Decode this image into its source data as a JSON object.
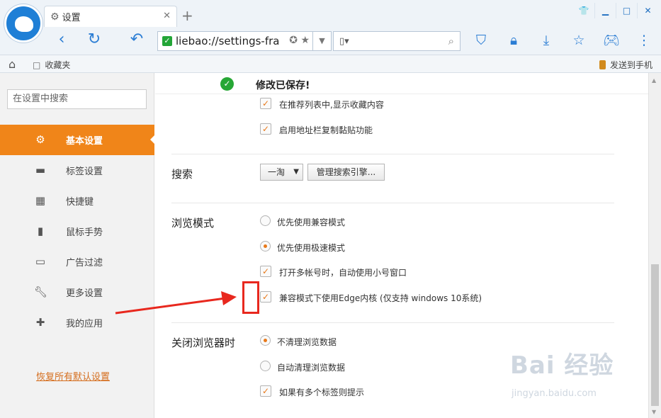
{
  "browser": {
    "tab_title": "设置",
    "tab_close": "✕",
    "new_tab": "+",
    "address_url": "liebao://settings-fra",
    "search_placeholder": "",
    "window_controls": [
      "shirt-icon",
      "minimize-icon",
      "maximize-icon",
      "close-icon"
    ]
  },
  "bookmarks": {
    "favorites_label": "收藏夹",
    "send_to_phone": "发送到手机"
  },
  "sidebar": {
    "search_placeholder": "在设置中搜索",
    "items": [
      {
        "label": "基本设置",
        "icon": "gear-icon",
        "active": true
      },
      {
        "label": "标签设置",
        "icon": "laptop-icon",
        "active": false
      },
      {
        "label": "快捷键",
        "icon": "keyboard-icon",
        "active": false
      },
      {
        "label": "鼠标手势",
        "icon": "mouse-icon",
        "active": false
      },
      {
        "label": "广告过滤",
        "icon": "window-icon",
        "active": false
      },
      {
        "label": "更多设置",
        "icon": "wrench-icon",
        "active": false
      },
      {
        "label": "我的应用",
        "icon": "puzzle-icon",
        "active": false
      }
    ],
    "reset_link": "恢复所有默认设置"
  },
  "content": {
    "saved_message": "修改已保存!",
    "top_options": [
      {
        "label": "在推荐列表中,显示收藏内容",
        "checked": true
      },
      {
        "label": "启用地址栏复制黏贴功能",
        "checked": true
      }
    ],
    "search_section": {
      "title": "搜索",
      "engine": "一淘",
      "manage_button": "管理搜索引擎..."
    },
    "browse_mode": {
      "title": "浏览模式",
      "radio_compat": "优先使用兼容模式",
      "radio_speed": "优先使用极速模式",
      "selected": "优先使用极速模式",
      "check_multi_account": "打开多帐号时，自动使用小号窗口",
      "check_edge": "兼容模式下使用Edge内核 (仅支持 windows 10系统)"
    },
    "close_section": {
      "title": "关闭浏览器时",
      "radio_keep": "不清理浏览数据",
      "radio_clear": "自动清理浏览数据",
      "selected": "不清理浏览数据",
      "check_multi_tab": "如果有多个标签则提示"
    }
  },
  "watermark": {
    "text": "Bai 经验",
    "sub": "jingyan.baidu.com"
  },
  "colors": {
    "accent": "#f08519",
    "annotation": "#e8281e",
    "brand_blue": "#2b7dd4"
  }
}
